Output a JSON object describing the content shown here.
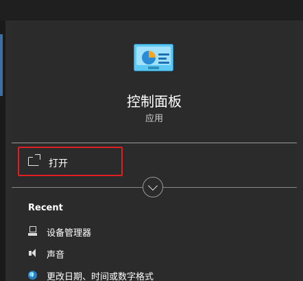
{
  "app": {
    "title": "控制面板",
    "type": "应用"
  },
  "actions": {
    "open_label": "打开"
  },
  "recent": {
    "heading": "Recent",
    "items": [
      {
        "label": "设备管理器",
        "icon": "device-manager-icon"
      },
      {
        "label": "声音",
        "icon": "speaker-icon"
      },
      {
        "label": "更改日期、时间或数字格式",
        "icon": "clock-globe-icon"
      }
    ]
  },
  "colors": {
    "panel_bg": "#2b2b2b",
    "highlight_border": "#e02020",
    "divider": "#9a9a9a"
  }
}
